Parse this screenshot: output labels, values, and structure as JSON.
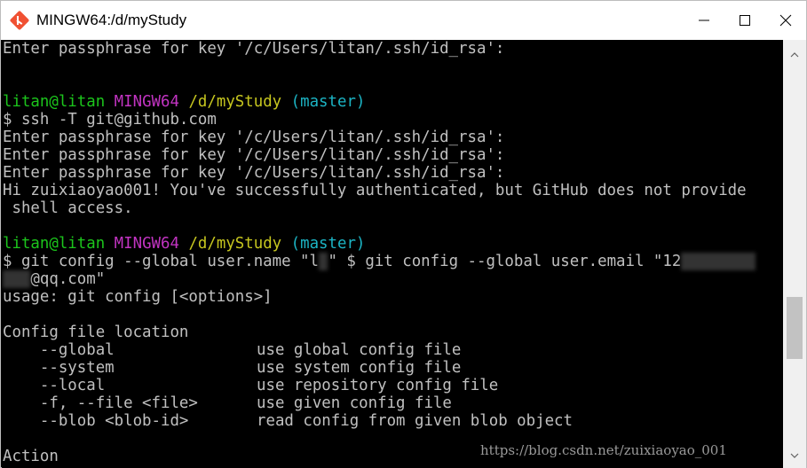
{
  "window": {
    "title": "MINGW64:/d/myStudy"
  },
  "icons": {
    "app": "git-bash-icon",
    "minimize": "minimize-icon",
    "maximize": "maximize-icon",
    "close": "close-icon",
    "scroll_up": "scroll-up-icon",
    "scroll_down": "scroll-down-icon"
  },
  "colors": {
    "background": "#000000",
    "text": "#c0c0c0",
    "user_host": "#1cc51c",
    "env": "#c234c2",
    "path": "#c6c61f",
    "branch": "#1cb4c4"
  },
  "terminal": {
    "line01": "Enter passphrase for key '/c/Users/litan/.ssh/id_rsa':",
    "prompt1": {
      "user_host": "litan@litan",
      "env": "MINGW64",
      "path": "/d/myStudy",
      "branch": "(master)"
    },
    "line05": "$ ssh -T git@github.com",
    "line06": "Enter passphrase for key '/c/Users/litan/.ssh/id_rsa':",
    "line07": "Enter passphrase for key '/c/Users/litan/.ssh/id_rsa':",
    "line08": "Enter passphrase for key '/c/Users/litan/.ssh/id_rsa':",
    "line09": "Hi zuixiaoyao001! You've successfully authenticated, but GitHub does not provide",
    "line10": " shell access.",
    "prompt2": {
      "user_host": "litan@litan",
      "env": "MINGW64",
      "path": "/d/myStudy",
      "branch": "(master)"
    },
    "line13a": "$ git config --global user.name \"l",
    "line13b": "y",
    "line13c": "\" $ git config --global user.email \"12",
    "line13d": "XXXXXXXX",
    "line14a": "XXX",
    "line14b": "@qq.com\"",
    "line15": "usage: git config [<options>]",
    "line17": "Config file location",
    "opt1_flag": "    --global",
    "opt1_desc": "use global config file",
    "opt2_flag": "    --system",
    "opt2_desc": "use system config file",
    "opt3_flag": "    --local",
    "opt3_desc": "use repository config file",
    "opt4_flag": "    -f, --file <file>",
    "opt4_desc": "use given config file",
    "opt5_flag": "    --blob <blob-id>",
    "opt5_desc": "read config from given blob object",
    "line24": "Action"
  },
  "watermark": "https://blog.csdn.net/zuixiaoyao_001"
}
